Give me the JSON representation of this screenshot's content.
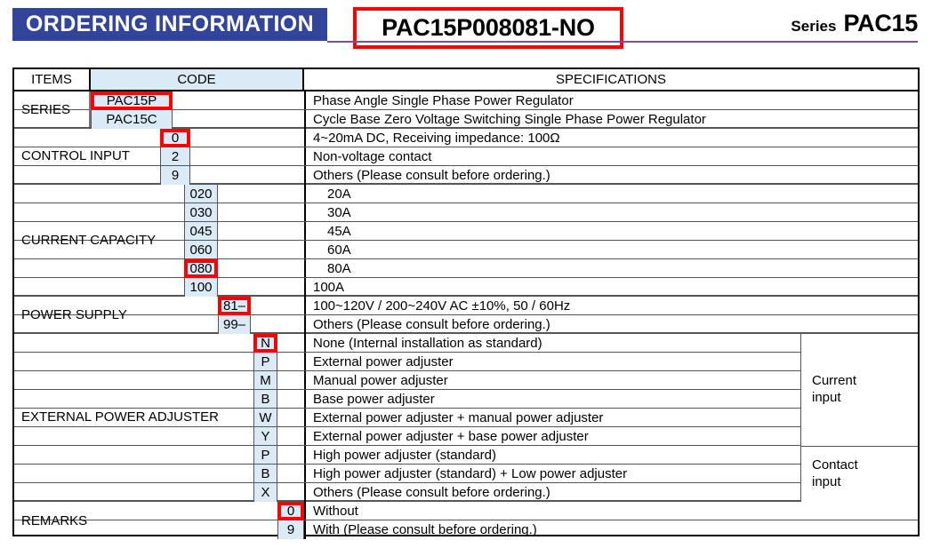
{
  "header": {
    "banner_title": "ORDERING INFORMATION",
    "part_number": "PAC15P008081-NO",
    "series_label": "Series",
    "series_value": "PAC15"
  },
  "table": {
    "columns": {
      "items": "ITEMS",
      "code": "CODE",
      "specifications": "SPECIFICATIONS"
    },
    "groups": [
      {
        "label": "SERIES",
        "rows": [
          {
            "code": "PAC15P",
            "spec": "Phase Angle Single Phase Power Regulator",
            "selected": true
          },
          {
            "code": "PAC15C",
            "spec": "Cycle Base Zero Voltage Switching Single Phase Power Regulator",
            "selected": false
          }
        ]
      },
      {
        "label": "CONTROL INPUT",
        "rows": [
          {
            "code": "0",
            "spec": "4~20mA DC, Receiving impedance:  100Ω",
            "selected": true
          },
          {
            "code": "2",
            "spec": "Non-voltage contact",
            "selected": false
          },
          {
            "code": "9",
            "spec": "Others (Please consult before ordering.)",
            "selected": false
          }
        ]
      },
      {
        "label": "CURRENT CAPACITY",
        "rows": [
          {
            "code": "020",
            "spec": "20A",
            "selected": false
          },
          {
            "code": "030",
            "spec": "30A",
            "selected": false
          },
          {
            "code": "045",
            "spec": "45A",
            "selected": false
          },
          {
            "code": "060",
            "spec": "60A",
            "selected": false
          },
          {
            "code": "080",
            "spec": "80A",
            "selected": true
          },
          {
            "code": "100",
            "spec": "100A",
            "selected": false
          }
        ]
      },
      {
        "label": "POWER SUPPLY",
        "rows": [
          {
            "code": "81–",
            "spec": "100~120V / 200~240V AC ±10%,  50 / 60Hz",
            "selected": true
          },
          {
            "code": "99–",
            "spec": "Others (Please consult before ordering.)",
            "selected": false
          }
        ]
      },
      {
        "label": "EXTERNAL POWER ADJUSTER",
        "rows": [
          {
            "code": "N",
            "spec": "None (Internal installation as standard)",
            "selected": true
          },
          {
            "code": "P",
            "spec": "External power adjuster",
            "selected": false
          },
          {
            "code": "M",
            "spec": "Manual power adjuster",
            "selected": false
          },
          {
            "code": "B",
            "spec": "Base power adjuster",
            "selected": false
          },
          {
            "code": "W",
            "spec": "External power adjuster + manual power adjuster",
            "selected": false
          },
          {
            "code": "Y",
            "spec": "External power adjuster + base power adjuster",
            "selected": false
          },
          {
            "code": "P",
            "spec": "High power adjuster (standard)",
            "selected": false
          },
          {
            "code": "B",
            "spec": "High power adjuster (standard) + Low power adjuster",
            "selected": false
          },
          {
            "code": "X",
            "spec": "Others (Please consult before ordering.)",
            "selected": false
          }
        ],
        "input_types": [
          {
            "line1": "Current",
            "line2": "input"
          },
          {
            "line1": "Contact",
            "line2": "input"
          }
        ]
      },
      {
        "label": "REMARKS",
        "rows": [
          {
            "code": "0",
            "spec": "Without",
            "selected": true
          },
          {
            "code": "9",
            "spec": "With (Please consult before ordering.)",
            "selected": false
          }
        ]
      }
    ]
  },
  "colors": {
    "banner_blue": "#33459b",
    "code_fill": "#dbeaf7",
    "highlight_red": "#ff0000",
    "rule_purple": "#7b4f9d"
  }
}
